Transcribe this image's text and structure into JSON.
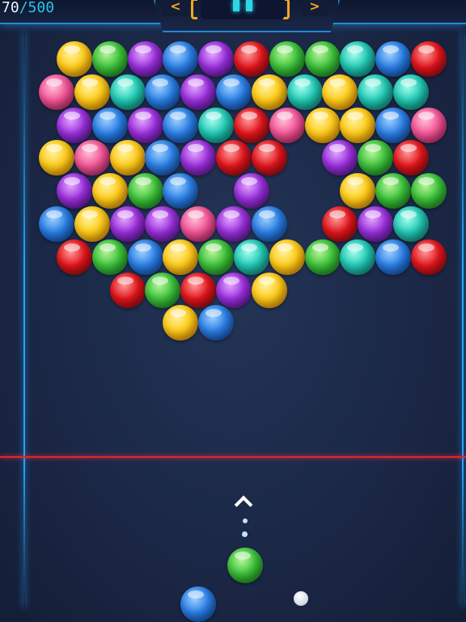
{
  "hud": {
    "score": "70",
    "separator": "/",
    "target": "500",
    "pause_icon": "pause-icon",
    "arrow_left_icon": "chevron-left-icon",
    "arrow_right_icon": "chevron-right-icon",
    "arrow_left_glyph": "<",
    "arrow_right_glyph": ">"
  },
  "colors": {
    "accent": "#1e8bd6",
    "deadline": "#e0252f",
    "background": "#1b2847"
  },
  "grid": {
    "rows": [
      [
        "yellow",
        "green",
        "purple",
        "blue",
        "purple",
        "red",
        "green",
        "green",
        "teal",
        "blue",
        "red"
      ],
      [
        "pink",
        "yellow",
        "teal",
        "blue",
        "purple",
        "blue",
        "yellow",
        "teal",
        "yellow",
        "teal",
        "teal"
      ],
      [
        "purple",
        "blue",
        "purple",
        "blue",
        "teal",
        "red",
        "pink",
        "yellow",
        "yellow",
        "blue",
        "pink"
      ],
      [
        "yellow",
        "pink",
        "yellow",
        "blue",
        "purple",
        "red",
        "red",
        null,
        "purple",
        "green",
        "red"
      ],
      [
        "purple",
        "yellow",
        "green",
        "blue",
        null,
        "purple",
        null,
        null,
        "yellow",
        "green",
        "green"
      ],
      [
        "blue",
        "yellow",
        "purple",
        "purple",
        "pink",
        "purple",
        "blue",
        null,
        "red",
        "purple",
        "teal"
      ],
      [
        "red",
        "green",
        "blue",
        "yellow",
        "green",
        "teal",
        "yellow",
        "green",
        "teal",
        "blue",
        "red"
      ],
      [
        null,
        null,
        "red",
        "green",
        "red",
        "purple",
        "yellow",
        null,
        null,
        null,
        null
      ],
      [
        null,
        null,
        null,
        "yellow",
        "blue",
        null,
        null,
        null,
        null,
        null,
        null
      ]
    ]
  },
  "shooter": {
    "current_color": "green",
    "next_color": "blue",
    "aim_icon": "chevron-up-icon"
  }
}
